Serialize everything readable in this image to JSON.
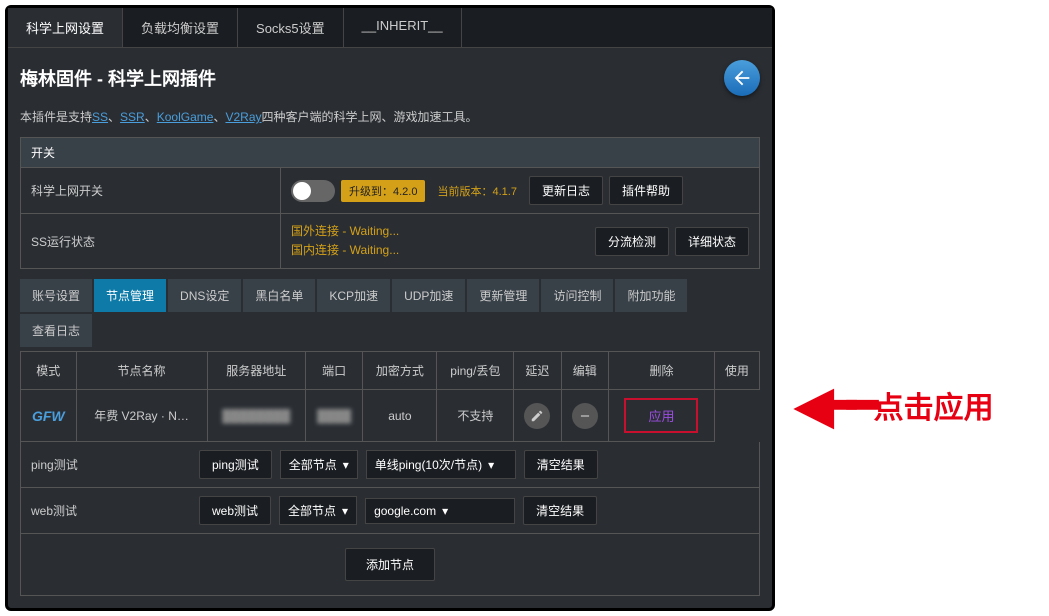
{
  "tabs": [
    "科学上网设置",
    "负载均衡设置",
    "Socks5设置",
    "__INHERIT__"
  ],
  "title": "梅林固件 - 科学上网插件",
  "desc": {
    "prefix": "本插件是支持",
    "links": [
      "SS",
      "SSR",
      "KoolGame",
      "V2Ray"
    ],
    "suffix": "四种客户端的科学上网、游戏加速工具。"
  },
  "switch": {
    "header": "开关",
    "label": "科学上网开关",
    "upgrade": "升级到：4.2.0",
    "current": "当前版本：4.1.7",
    "changelog": "更新日志",
    "help": "插件帮助"
  },
  "status": {
    "label": "SS运行状态",
    "line1": "国外连接 - Waiting...",
    "line2": "国内连接 - Waiting...",
    "flow": "分流检测",
    "detail": "详细状态"
  },
  "subtabs": [
    "账号设置",
    "节点管理",
    "DNS设定",
    "黑白名单",
    "KCP加速",
    "UDP加速",
    "更新管理",
    "访问控制",
    "附加功能",
    "查看日志"
  ],
  "table": {
    "headers": [
      "模式",
      "节点名称",
      "服务器地址",
      "端口",
      "加密方式",
      "ping/丢包",
      "延迟",
      "编辑",
      "删除",
      "使用"
    ],
    "row": {
      "mode": "GFW",
      "name": "年费 V2Ray · N…",
      "enc": "auto",
      "ping": "不支持",
      "apply": "应用"
    }
  },
  "pingtest": {
    "label": "ping测试",
    "btn": "ping测试",
    "nodes": "全部节点",
    "mode": "单线ping(10次/节点)",
    "clear": "清空结果"
  },
  "webtest": {
    "label": "web测试",
    "btn": "web测试",
    "nodes": "全部节点",
    "site": "google.com",
    "clear": "清空结果"
  },
  "add": "添加节点",
  "annotation": "点击应用"
}
